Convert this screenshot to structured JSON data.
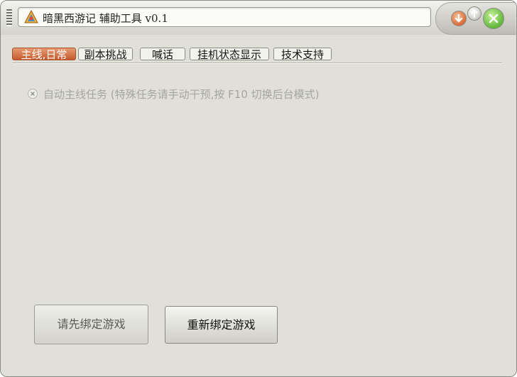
{
  "window": {
    "title": "暗黑西游记  辅助工具  v0.1",
    "icons": {
      "grip": "drag-grip-icon",
      "app": "app-logo-icon",
      "minimize": "down-arrow-icon",
      "restore": "up-arrow-icon",
      "close": "close-icon"
    }
  },
  "tabs": [
    {
      "label": "主线,日常",
      "active": true
    },
    {
      "label": "副本挑战",
      "active": false
    },
    {
      "label": "喊话",
      "active": false
    },
    {
      "label": "挂机状态显示",
      "active": false
    },
    {
      "label": "技术支持",
      "active": false
    }
  ],
  "main": {
    "auto_quest": {
      "label": "自动主线任务 (特殊任务请手动干预,按 F10 切换后台模式)",
      "state": "disabled",
      "icon": "disabled-radio-icon"
    },
    "buttons": {
      "bind_first": "请先绑定游戏",
      "rebind": "重新绑定游戏"
    }
  },
  "colors": {
    "active_tab": "#c65a2e",
    "window_bg": "#e0dfd8",
    "disabled_text": "#a6a6a0",
    "close_button": "#5fb83a",
    "minimize_button": "#d96a36"
  }
}
